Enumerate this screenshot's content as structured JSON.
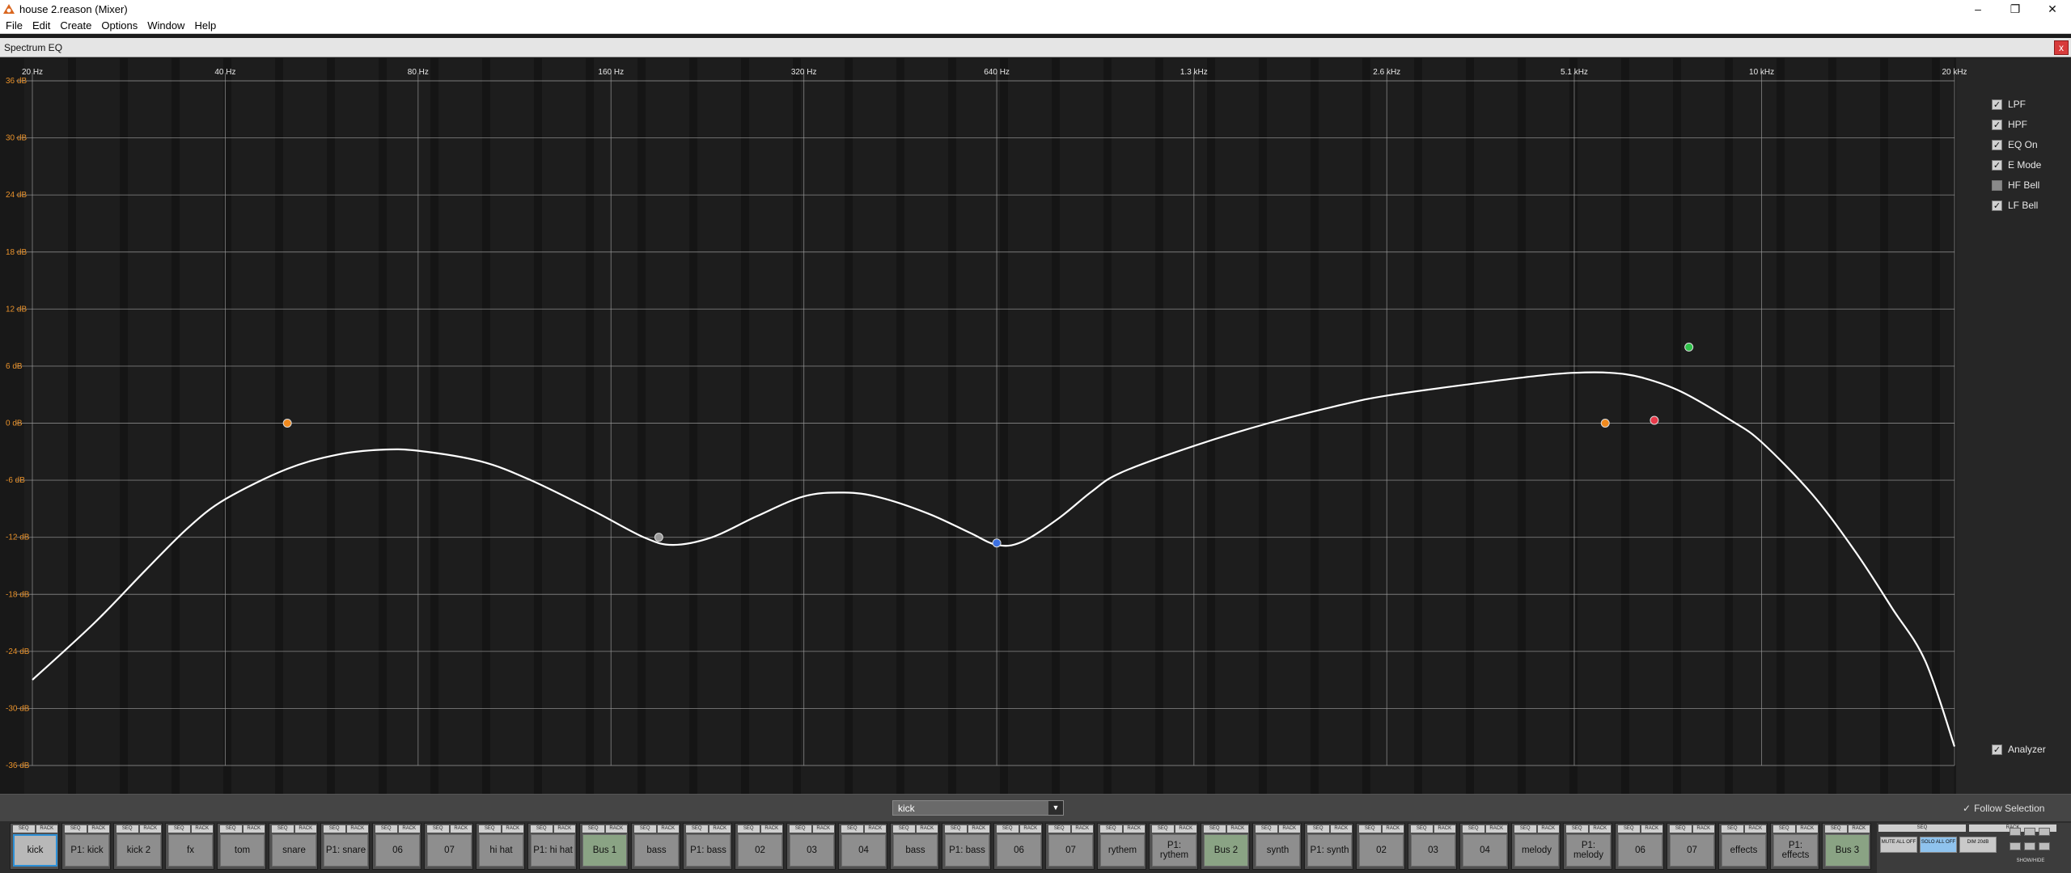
{
  "window": {
    "title": "house 2.reason (Mixer)"
  },
  "menu": [
    "File",
    "Edit",
    "Create",
    "Options",
    "Window",
    "Help"
  ],
  "eq_panel": {
    "title": "Spectrum EQ",
    "close_label": "x"
  },
  "freq_labels": [
    "20 Hz",
    "40 Hz",
    "80 Hz",
    "160 Hz",
    "320 Hz",
    "640 Hz",
    "1.3 kHz",
    "2.6 kHz",
    "5.1 kHz",
    "10 kHz",
    "20 kHz"
  ],
  "db_labels": [
    "36 dB",
    "30 dB",
    "24 dB",
    "18 dB",
    "12 dB",
    "6 dB",
    "0 dB",
    "-6 dB",
    "-12 dB",
    "-18 dB",
    "-24 dB",
    "-30 dB",
    "-36 dB"
  ],
  "db_values": [
    36,
    30,
    24,
    18,
    12,
    6,
    0,
    -6,
    -12,
    -18,
    -24,
    -30,
    -36
  ],
  "freq_values": [
    20,
    40,
    80,
    160,
    320,
    640,
    1300,
    2600,
    5100,
    10000,
    20000
  ],
  "options": [
    {
      "label": "LPF",
      "checked": true
    },
    {
      "label": "HPF",
      "checked": true
    },
    {
      "label": "EQ On",
      "checked": true
    },
    {
      "label": "E Mode",
      "checked": true
    },
    {
      "label": "HF Bell",
      "checked": false
    },
    {
      "label": "LF Bell",
      "checked": true
    }
  ],
  "analyzer": {
    "label": "Analyzer",
    "checked": true
  },
  "eq_points": [
    {
      "name": "lf-band",
      "freq_hz": 50,
      "gain_db": 0,
      "color": "#f08a1f"
    },
    {
      "name": "lmf-band",
      "freq_hz": 190,
      "gain_db": -12,
      "color": "#9a9a9a"
    },
    {
      "name": "mf-band",
      "freq_hz": 640,
      "gain_db": -12.6,
      "color": "#3b6fe0"
    },
    {
      "name": "hmf-band",
      "freq_hz": 5700,
      "gain_db": 0,
      "color": "#f08a1f"
    },
    {
      "name": "hf-band",
      "freq_hz": 6800,
      "gain_db": 0.3,
      "color": "#e83a4a"
    },
    {
      "name": "lpf-point",
      "freq_hz": 7700,
      "gain_db": 8,
      "color": "#2fc24a"
    }
  ],
  "eq_curve": [
    [
      20,
      -27
    ],
    [
      25,
      -21
    ],
    [
      30,
      -15.5
    ],
    [
      35,
      -11
    ],
    [
      40,
      -8
    ],
    [
      50,
      -4.8
    ],
    [
      60,
      -3.3
    ],
    [
      70,
      -2.8
    ],
    [
      80,
      -2.9
    ],
    [
      100,
      -4
    ],
    [
      120,
      -6
    ],
    [
      150,
      -9.2
    ],
    [
      180,
      -12
    ],
    [
      200,
      -12.8
    ],
    [
      230,
      -12
    ],
    [
      270,
      -9.8
    ],
    [
      320,
      -7.7
    ],
    [
      370,
      -7.3
    ],
    [
      420,
      -7.8
    ],
    [
      500,
      -9.5
    ],
    [
      580,
      -11.5
    ],
    [
      640,
      -12.8
    ],
    [
      700,
      -12.5
    ],
    [
      800,
      -10
    ],
    [
      900,
      -7.2
    ],
    [
      1000,
      -5.2
    ],
    [
      1300,
      -2.4
    ],
    [
      1700,
      0
    ],
    [
      2200,
      1.9
    ],
    [
      2600,
      2.9
    ],
    [
      3500,
      4.1
    ],
    [
      4500,
      5
    ],
    [
      5100,
      5.3
    ],
    [
      5800,
      5.3
    ],
    [
      6500,
      4.8
    ],
    [
      7500,
      3.3
    ],
    [
      9000,
      0.2
    ],
    [
      10000,
      -2
    ],
    [
      12000,
      -7.5
    ],
    [
      14000,
      -13.5
    ],
    [
      16000,
      -19.5
    ],
    [
      18000,
      -25
    ],
    [
      20000,
      -34
    ]
  ],
  "channel_selector": {
    "value": "kick"
  },
  "follow_selection": {
    "label": "Follow Selection",
    "checked": true
  },
  "strip_buttons": {
    "seq": "SEQ",
    "rack": "RACK"
  },
  "channels": [
    {
      "name": "kick",
      "bus": false,
      "selected": true
    },
    {
      "name": "P1: kick",
      "bus": false
    },
    {
      "name": "kick 2",
      "bus": false
    },
    {
      "name": "fx",
      "bus": false
    },
    {
      "name": "tom",
      "bus": false
    },
    {
      "name": "snare",
      "bus": false
    },
    {
      "name": "P1: snare",
      "bus": false
    },
    {
      "name": "06",
      "bus": false
    },
    {
      "name": "07",
      "bus": false
    },
    {
      "name": "hi hat",
      "bus": false
    },
    {
      "name": "P1: hi hat",
      "bus": false
    },
    {
      "name": "Bus 1",
      "bus": true
    },
    {
      "name": "bass",
      "bus": false
    },
    {
      "name": "P1: bass",
      "bus": false
    },
    {
      "name": "02",
      "bus": false
    },
    {
      "name": "03",
      "bus": false
    },
    {
      "name": "04",
      "bus": false
    },
    {
      "name": "bass",
      "bus": false
    },
    {
      "name": "P1: bass",
      "bus": false
    },
    {
      "name": "06",
      "bus": false
    },
    {
      "name": "07",
      "bus": false
    },
    {
      "name": "rythem",
      "bus": false
    },
    {
      "name": "P1: rythem",
      "bus": false
    },
    {
      "name": "Bus 2",
      "bus": true
    },
    {
      "name": "synth",
      "bus": false
    },
    {
      "name": "P1: synth",
      "bus": false
    },
    {
      "name": "02",
      "bus": false
    },
    {
      "name": "03",
      "bus": false
    },
    {
      "name": "04",
      "bus": false
    },
    {
      "name": "melody",
      "bus": false
    },
    {
      "name": "P1: melody",
      "bus": false
    },
    {
      "name": "06",
      "bus": false
    },
    {
      "name": "07",
      "bus": false
    },
    {
      "name": "effects",
      "bus": false
    },
    {
      "name": "P1: effects",
      "bus": false
    },
    {
      "name": "Bus 3",
      "bus": true
    }
  ],
  "master": {
    "seq": "SEQ",
    "rack": "RACK",
    "mute_all": "MUTE ALL OFF",
    "solo_all": "SOLO ALL OFF",
    "dim": "DIM 20dB",
    "show_hide": "SHOW/HIDE"
  }
}
